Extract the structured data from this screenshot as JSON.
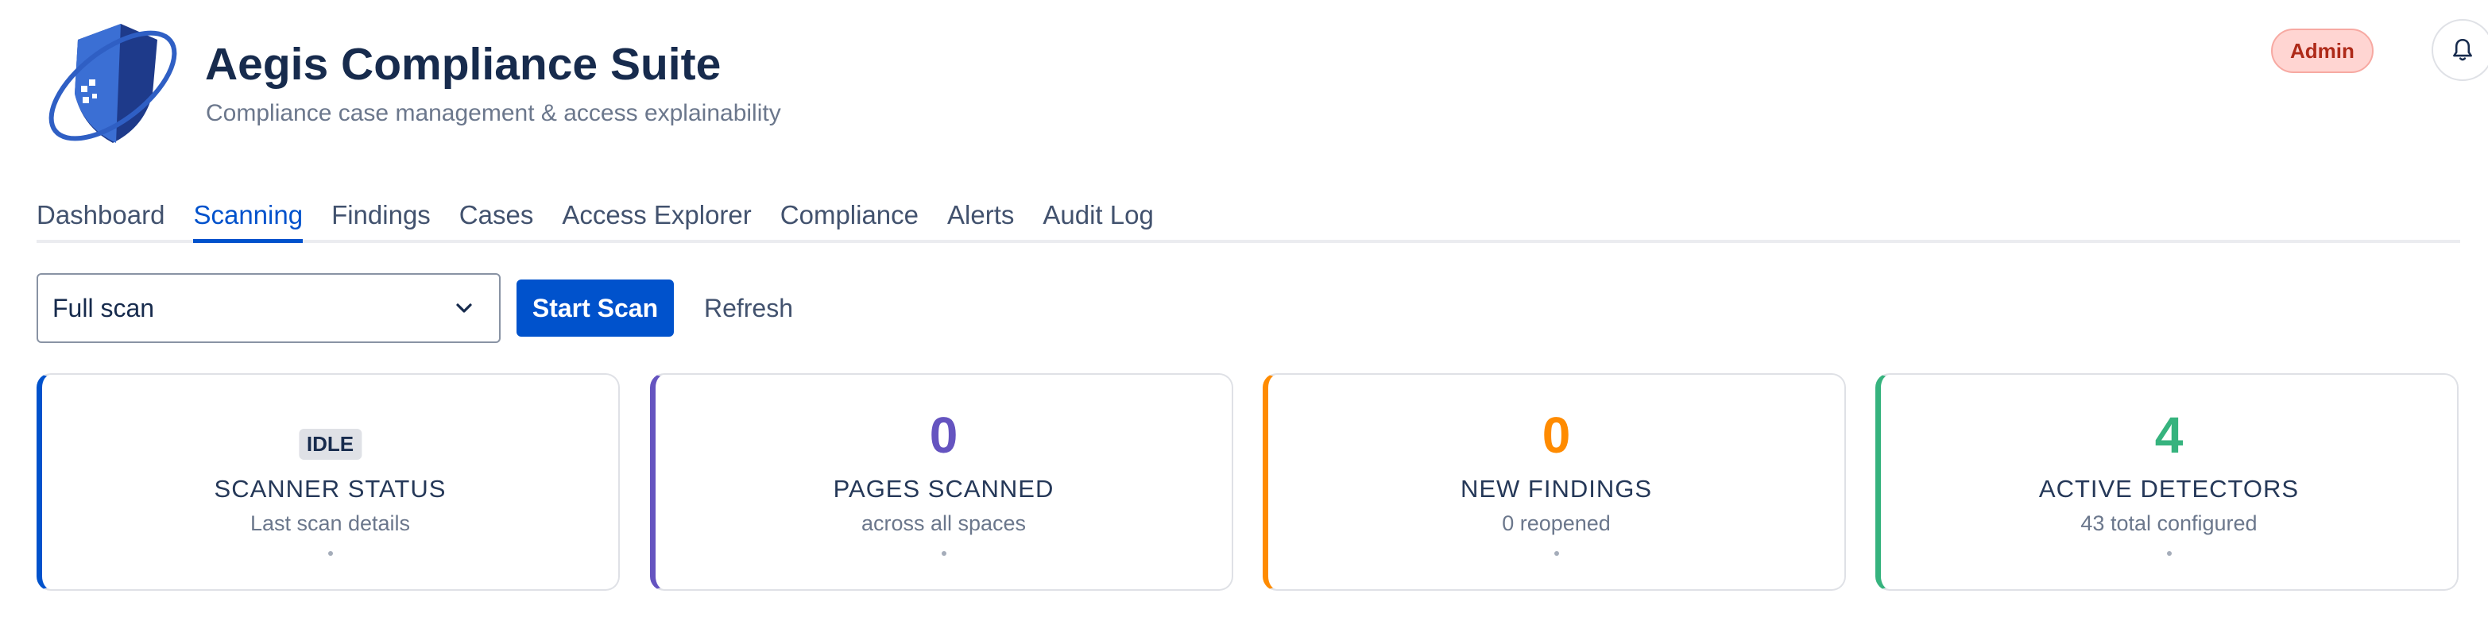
{
  "app": {
    "title": "Aegis Compliance Suite",
    "subtitle": "Compliance case management & access explainability",
    "logo_icon": "shield-logo-icon"
  },
  "header": {
    "role_badge": "Admin",
    "notifications_icon": "bell-icon"
  },
  "tabs": [
    {
      "label": "Dashboard",
      "active": false
    },
    {
      "label": "Scanning",
      "active": true
    },
    {
      "label": "Findings",
      "active": false
    },
    {
      "label": "Cases",
      "active": false
    },
    {
      "label": "Access Explorer",
      "active": false
    },
    {
      "label": "Compliance",
      "active": false
    },
    {
      "label": "Alerts",
      "active": false
    },
    {
      "label": "Audit Log",
      "active": false
    }
  ],
  "toolbar": {
    "scan_type_selected": "Full scan",
    "start_label": "Start Scan",
    "refresh_label": "Refresh"
  },
  "cards": [
    {
      "status": "IDLE",
      "label": "SCANNER STATUS",
      "sub": "Last scan details",
      "dot": "•",
      "accent": "#0052cc"
    },
    {
      "value": "0",
      "label": "PAGES SCANNED",
      "sub": "across all spaces",
      "dot": "•",
      "accent": "#6554c0"
    },
    {
      "value": "0",
      "label": "NEW FINDINGS",
      "sub": "0 reopened",
      "dot": "•",
      "accent": "#ff8b00"
    },
    {
      "value": "4",
      "label": "ACTIVE DETECTORS",
      "sub": "43 total configured",
      "dot": "•",
      "accent": "#36b37e"
    }
  ],
  "colors": {
    "primary": "#0052cc",
    "text": "#172b4d",
    "muted": "#6b778c"
  }
}
